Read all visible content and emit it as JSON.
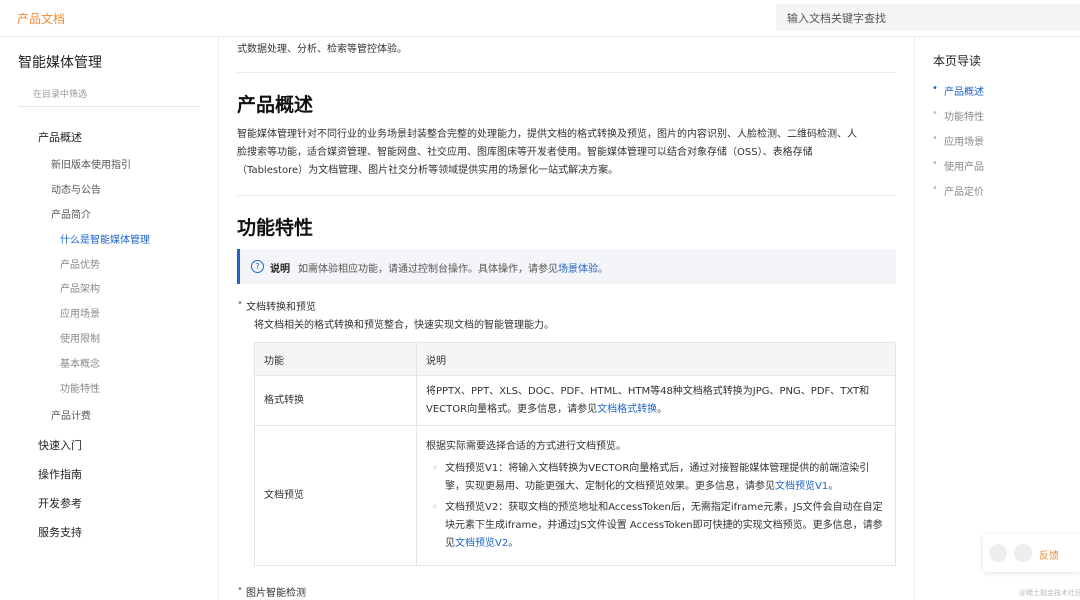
{
  "header": {
    "brand": "产品文档",
    "search_placeholder": "输入文档关键字查找"
  },
  "sidebar": {
    "title": "智能媒体管理",
    "filter_placeholder": "在目录中筛选",
    "items": [
      {
        "label": "产品概述"
      },
      {
        "label": "新旧版本使用指引"
      },
      {
        "label": "动态与公告"
      },
      {
        "label": "产品简介"
      },
      {
        "label": "什么是智能媒体管理"
      },
      {
        "label": "产品优势"
      },
      {
        "label": "产品架构"
      },
      {
        "label": "应用场景"
      },
      {
        "label": "使用限制"
      },
      {
        "label": "基本概念"
      },
      {
        "label": "功能特性"
      },
      {
        "label": "产品计费"
      },
      {
        "label": "快速入门"
      },
      {
        "label": "操作指南"
      },
      {
        "label": "开发参考"
      },
      {
        "label": "服务支持"
      }
    ]
  },
  "main": {
    "intro_tail": "式数据处理、分析、检索等管控体验。",
    "overview": {
      "heading": "产品概述",
      "line1": "智能媒体管理针对不同行业的业务场景封装整合完整的处理能力，提供文档的格式转换及预览，图片的内容识别、人脸检测、二维码检测、人",
      "line2": "脸搜索等功能，适合媒资管理、智能网盘、社交应用、图库图床等开发者使用。智能媒体管理可以结合对象存储（OSS）、表格存储",
      "line3": "（Tablestore）为文档管理、图片社交分析等领域提供实用的场景化一站式解决方案。"
    },
    "features": {
      "heading": "功能特性",
      "note_label": "说明",
      "note_text": "如需体验相应功能，请通过控制台操作。具体操作，请参见",
      "note_link": "场景体验",
      "note_end": "。",
      "bullet1": "文档转换和预览",
      "bullet1_desc": "将文档相关的格式转换和预览整合，快速实现文档的智能管理能力。",
      "table": {
        "col1": "功能",
        "col2": "说明",
        "row1_name": "格式转换",
        "row1_text1": "将PPTX、PPT、XLS、DOC、PDF、HTML、HTM等48种文档格式转换为JPG、PNG、PDF、TXT和",
        "row1_text2": "VECTOR向量格式。更多信息，请参见",
        "row1_link": "文档格式转换",
        "row1_end": "。",
        "row2_name": "文档预览",
        "row2_intro": "根据实际需要选择合适的方式进行文档预览。",
        "row2_v1": "文档预览V1：将输入文档转换为VECTOR向量格式后，通过对接智能媒体管理提供的前端渲染引擎，实现更易用、功能更强大、定制化的文档预览效果。更多信息，请参见",
        "row2_v1_link": "文档预览V1",
        "row2_v1_end": "。",
        "row2_v2": "文档预览V2：获取文档的预览地址和AccessToken后，无需指定iframe元素，JS文件会自动在自定块元素下生成iframe，并通过JS文件设置 AccessToken即可快捷的实现文档预览。更多信息，请参见",
        "row2_v2_link": "文档预览V2",
        "row2_v2_end": "。"
      },
      "bullet2": "图片智能检测"
    }
  },
  "toc": {
    "title": "本页导读",
    "items": [
      {
        "label": "产品概述"
      },
      {
        "label": "功能特性"
      },
      {
        "label": "应用场景"
      },
      {
        "label": "使用产品"
      },
      {
        "label": "产品定价"
      }
    ]
  },
  "feedback": {
    "label": "反馈"
  },
  "watermark": "@稀土掘金技术社区",
  "colors": {
    "accent": "#f08c32",
    "link": "#1e64c8"
  }
}
